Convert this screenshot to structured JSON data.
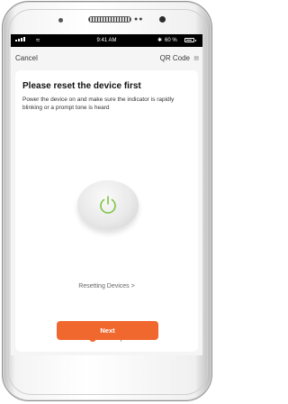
{
  "status_bar": {
    "time": "9:41 AM",
    "bluetooth_icon": "bluetooth-icon",
    "battery_text": "60 %",
    "battery_level": 0.6
  },
  "nav": {
    "cancel_label": "Cancel",
    "qr_label": "QR Code",
    "qr_icon": "qr-code-icon"
  },
  "content": {
    "title": "Please reset the device first",
    "description": "Power the device on and make sure the indicator is rapidly blinking or a prompt tone is heard",
    "device_icon": "power-icon",
    "resetting_link": "Resetting Devices >"
  },
  "confirm": {
    "label": "next step",
    "checked": true
  },
  "next_button": {
    "label": "Next"
  },
  "colors": {
    "accent": "#f0682e",
    "power_icon": "#7dc442"
  }
}
